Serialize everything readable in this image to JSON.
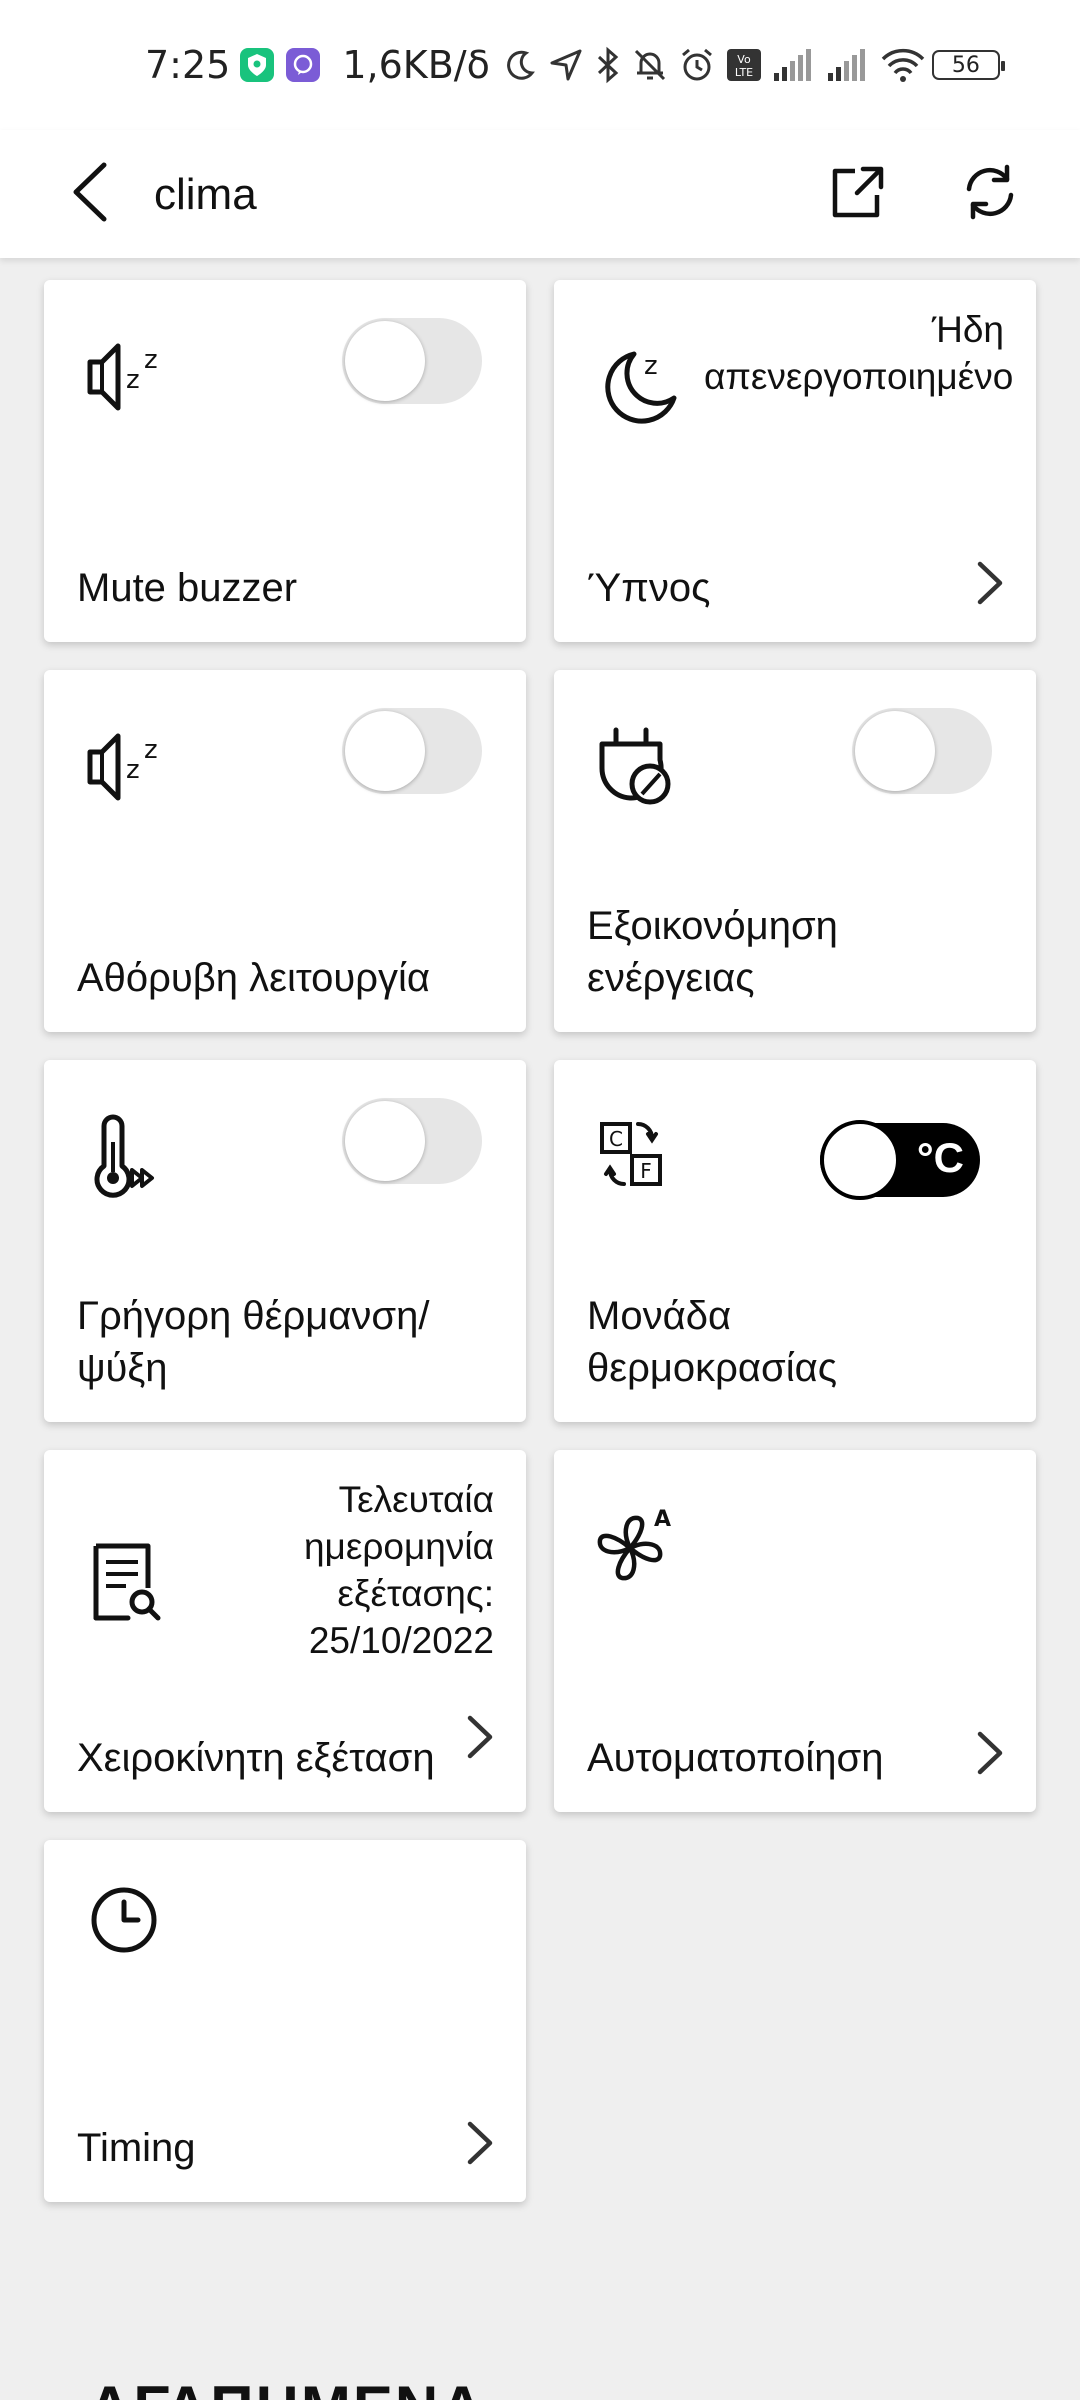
{
  "status_bar": {
    "time": "7:25",
    "speed": "1,6KB/δ",
    "battery": "56",
    "icons": [
      "shield-app-icon",
      "viber-app-icon",
      "moon-icon",
      "location-icon",
      "bluetooth-icon",
      "bell-off-icon",
      "alarm-icon",
      "volte-icon",
      "signal-icon",
      "signal-icon",
      "wifi-icon",
      "battery-icon"
    ]
  },
  "app_bar": {
    "title": "clima"
  },
  "cards": [
    {
      "id": "mute-buzzer",
      "label": "Mute buzzer",
      "control": "toggle",
      "on": false,
      "icon": "speaker-zz-icon"
    },
    {
      "id": "sleep",
      "label": "Ύπνος",
      "status": "Ήδη απενεργοποιημένο",
      "control": "chevron",
      "icon": "moon-z-icon"
    },
    {
      "id": "quiet-mode",
      "label": "Αθόρυβη λειτουργία",
      "control": "toggle",
      "on": false,
      "icon": "speaker-zz-icon"
    },
    {
      "id": "energy-saving",
      "label": "Εξοικονόμηση ενέργειας",
      "control": "toggle",
      "on": false,
      "icon": "plug-leaf-icon"
    },
    {
      "id": "fast-heat-cool",
      "label": "Γρήγορη θέρμανση/ ψύξη",
      "control": "toggle",
      "on": false,
      "icon": "thermometer-fast-icon"
    },
    {
      "id": "temperature-unit",
      "label": "Μονάδα θερμοκρασίας",
      "control": "unit-toggle",
      "unit": "°C",
      "icon": "c-f-switch-icon"
    },
    {
      "id": "manual-check",
      "label": "Χειροκίνητη εξέταση",
      "status": "Τελευταία ημερομηνία εξέτασης: 25/10/2022",
      "control": "chevron",
      "icon": "document-search-icon"
    },
    {
      "id": "automation",
      "label": "Αυτοματοποίηση",
      "control": "chevron",
      "icon": "fan-auto-icon"
    },
    {
      "id": "timing",
      "label": "Timing",
      "control": "chevron",
      "icon": "clock-icon"
    }
  ],
  "section_header": "ΑΓΑΠΗΜΕΝΑ"
}
